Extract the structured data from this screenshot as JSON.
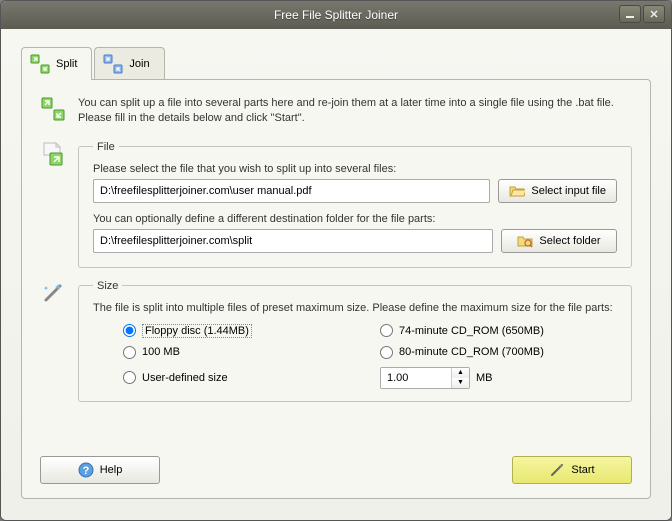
{
  "window": {
    "title": "Free File Splitter Joiner"
  },
  "tabs": {
    "split": "Split",
    "join": "Join"
  },
  "intro": "You can split up a file into several parts here and re-join them at a later time into a single file using the .bat file. Please fill in the details below and click \"Start\".",
  "file": {
    "legend": "File",
    "select_label": "Please select the file that you wish to split up into several files:",
    "input_path": "D:\\freefilesplitterjoiner.com\\user manual.pdf",
    "select_btn": "Select input file",
    "dest_label": "You can optionally define a different destination folder for the file parts:",
    "dest_path": "D:\\freefilesplitterjoiner.com\\split",
    "folder_btn": "Select folder"
  },
  "size": {
    "legend": "Size",
    "intro": "The file is split into multiple files of preset maximum size. Please define the maximum size for the file parts:",
    "options": {
      "floppy": "Floppy disc (1.44MB)",
      "cd74": "74-minute CD_ROM (650MB)",
      "mb100": "100 MB",
      "cd80": "80-minute CD_ROM (700MB)",
      "user": "User-defined size",
      "spinner_value": "1.00",
      "unit": "MB"
    }
  },
  "buttons": {
    "help": "Help",
    "start": "Start"
  }
}
